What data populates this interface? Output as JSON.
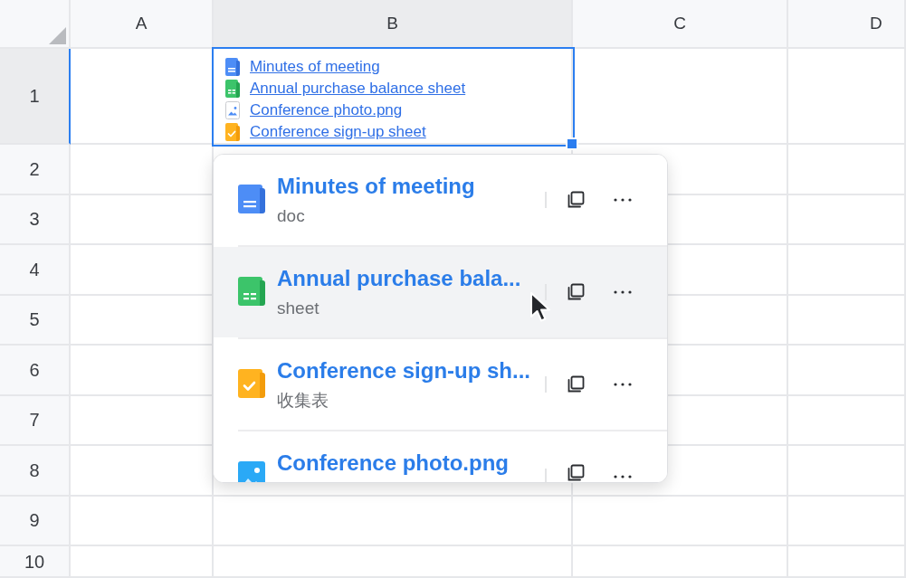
{
  "sheet": {
    "columns": [
      {
        "label": "A",
        "selected": false
      },
      {
        "label": "B",
        "selected": true
      },
      {
        "label": "C",
        "selected": false
      },
      {
        "label": "D",
        "selected": false
      }
    ],
    "rows": [
      {
        "label": "1",
        "selected": true
      },
      {
        "label": "2",
        "selected": false
      },
      {
        "label": "3",
        "selected": false
      },
      {
        "label": "4",
        "selected": false
      },
      {
        "label": "5",
        "selected": false
      },
      {
        "label": "6",
        "selected": false
      },
      {
        "label": "7",
        "selected": false
      },
      {
        "label": "8",
        "selected": false
      },
      {
        "label": "9",
        "selected": false
      },
      {
        "label": "10",
        "selected": false
      }
    ],
    "selected_cell": {
      "links": [
        {
          "kind": "doc",
          "text": "Minutes of meeting"
        },
        {
          "kind": "sheet",
          "text": "Annual purchase balance sheet"
        },
        {
          "kind": "image",
          "text": "Conference photo.png"
        },
        {
          "kind": "form",
          "text": "Conference sign-up sheet"
        }
      ]
    }
  },
  "link_popup": {
    "items": [
      {
        "kind": "doc",
        "title": "Minutes of meeting",
        "subtitle": "doc",
        "highlighted": false
      },
      {
        "kind": "sheet",
        "title": "Annual purchase bala...",
        "subtitle": "sheet",
        "highlighted": true
      },
      {
        "kind": "form",
        "title": "Conference sign-up sh...",
        "subtitle": "收集表",
        "highlighted": false
      },
      {
        "kind": "image",
        "title": "Conference photo.png",
        "highlighted": false
      }
    ]
  }
}
